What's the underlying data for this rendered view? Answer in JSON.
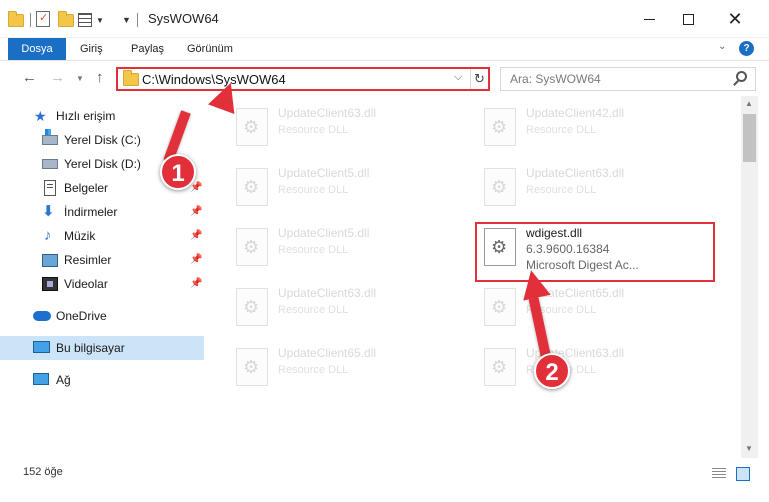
{
  "window": {
    "title": "SysWOW64",
    "minimize_icon": "minimize-icon",
    "maximize_icon": "maximize-icon",
    "close_icon": "close-icon",
    "close_glyph": "✕"
  },
  "ribbon": {
    "tabs": [
      {
        "label": "Dosya"
      },
      {
        "label": "Giriş"
      },
      {
        "label": "Paylaş"
      },
      {
        "label": "Görünüm"
      }
    ],
    "help_glyph": "?",
    "accent_color": "#1a6fc4"
  },
  "navbar": {
    "address": "C:\\Windows\\SysWOW64",
    "search_placeholder": "Ara: SysWOW64",
    "back_glyph": "←",
    "forward_glyph": "→",
    "up_glyph": "↑",
    "refresh_glyph": "↻",
    "dropdown_glyph": "⌵"
  },
  "sidebar": {
    "items": [
      {
        "label": "Hızlı erişim",
        "icon": "star-icon"
      },
      {
        "label": "Yerel Disk (C:)",
        "icon": "drive-icon"
      },
      {
        "label": "Yerel Disk (D:)",
        "icon": "drive-icon"
      },
      {
        "label": "Belgeler",
        "icon": "document-icon"
      },
      {
        "label": "İndirmeler",
        "icon": "download-icon"
      },
      {
        "label": "Müzik",
        "icon": "music-icon"
      },
      {
        "label": "Resimler",
        "icon": "picture-icon"
      },
      {
        "label": "Videolar",
        "icon": "video-icon"
      },
      {
        "label": "OneDrive",
        "icon": "cloud-icon"
      },
      {
        "label": "Bu bilgisayar",
        "icon": "computer-icon"
      },
      {
        "label": "Ağ",
        "icon": "network-icon"
      }
    ],
    "star_glyph": "★",
    "download_glyph": "⬇",
    "music_glyph": "♪",
    "pin_glyph": "📌"
  },
  "files": [
    {
      "name": "UpdateClient63.dll",
      "desc": "Resource DLL"
    },
    {
      "name": "UpdateClient42.dll",
      "desc": "Resource DLL"
    },
    {
      "name": "UpdateClient5.dll",
      "desc": "Resource DLL"
    },
    {
      "name": "UpdateClient63.dll",
      "desc": "Resource DLL"
    },
    {
      "name": "UpdateClient5.dll",
      "desc": "Resource DLL"
    },
    {
      "name": "wdigest.dll",
      "version": "6.3.9600.16384",
      "desc": "Microsoft Digest Ac..."
    },
    {
      "name": "UpdateClient63.dll",
      "desc": "Resource DLL"
    },
    {
      "name": "UpdateClient65.dll",
      "desc": "Resource DLL"
    },
    {
      "name": "UpdateClient65.dll",
      "desc": "Resource DLL"
    },
    {
      "name": "UpdateClient63.dll",
      "desc": "Resource DLL"
    }
  ],
  "status": {
    "item_count": "152 öğe"
  },
  "annotations": {
    "step1": "1",
    "step2": "2",
    "highlight_color": "#e2303a"
  }
}
